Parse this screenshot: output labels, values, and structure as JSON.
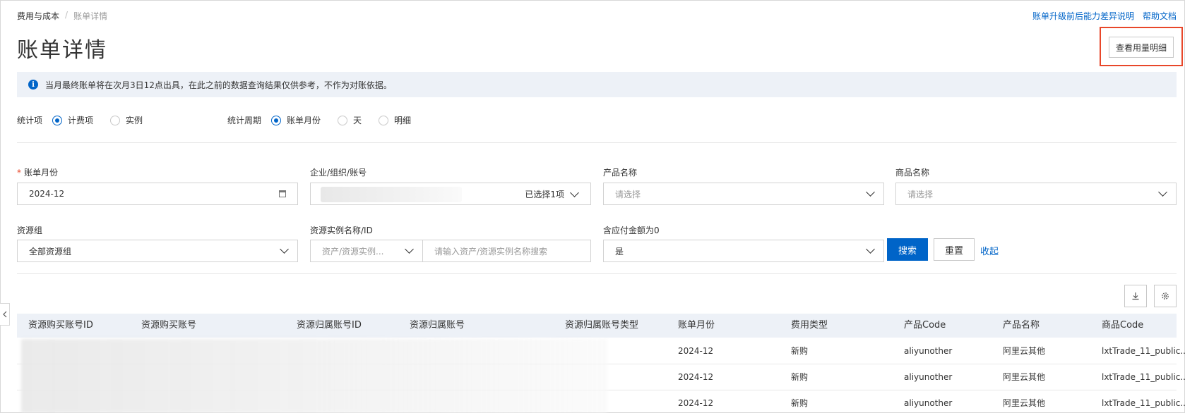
{
  "breadcrumb": {
    "parent": "费用与成本",
    "separator": "/",
    "current": "账单详情"
  },
  "top_links": {
    "upgrade_note": "账单升级前后能力差异说明",
    "help": "帮助文档"
  },
  "page_title": "账单详情",
  "usage_button": "查看用量明细",
  "notice": {
    "icon": "i",
    "text": "当月最终账单将在次月3日12点出具，在此之前的数据查询结果仅供参考，不作为对账依据。"
  },
  "stat_item": {
    "label": "统计项",
    "options": [
      "计费项",
      "实例"
    ],
    "selected": "计费项"
  },
  "stat_period": {
    "label": "统计周期",
    "options": [
      "账单月份",
      "天",
      "明细"
    ],
    "selected": "账单月份"
  },
  "filters": {
    "bill_month": {
      "required_mark": "*",
      "label": "账单月份",
      "value": "2024-12"
    },
    "account": {
      "label": "企业/组织/账号",
      "selected_text": "已选择1项"
    },
    "product_name": {
      "label": "产品名称",
      "placeholder": "请选择"
    },
    "commodity_name": {
      "label": "商品名称",
      "placeholder": "请选择"
    },
    "resource_group": {
      "label": "资源组",
      "value": "全部资源组"
    },
    "instance": {
      "label": "资源实例名称/ID",
      "type_value": "资产/资源实例...",
      "search_placeholder": "请输入资产/资源实例名称搜索"
    },
    "payable_zero": {
      "label": "含应付金额为0",
      "value": "是"
    }
  },
  "actions": {
    "search": "搜索",
    "reset": "重置",
    "collapse": "收起"
  },
  "table": {
    "columns": [
      "资源购买账号ID",
      "资源购买账号",
      "资源归属账号ID",
      "资源归属账号",
      "资源归属账号类型",
      "账单月份",
      "费用类型",
      "产品Code",
      "产品名称",
      "商品Code"
    ],
    "rows": [
      {
        "bill_month": "2024-12",
        "fee_type": "新购",
        "product_code": "aliyunother",
        "product_name": "阿里云其他",
        "commodity_code": "lxtTrade_11_public..."
      },
      {
        "bill_month": "2024-12",
        "fee_type": "新购",
        "product_code": "aliyunother",
        "product_name": "阿里云其他",
        "commodity_code": "lxtTrade_11_public..."
      },
      {
        "bill_month": "2024-12",
        "fee_type": "新购",
        "product_code": "aliyunother",
        "product_name": "阿里云其他",
        "commodity_code": "lxtTrade_11_public..."
      }
    ]
  },
  "colors": {
    "primary": "#0064c8",
    "highlight_border": "#e8472a",
    "notice_bg": "#edf1f7"
  }
}
